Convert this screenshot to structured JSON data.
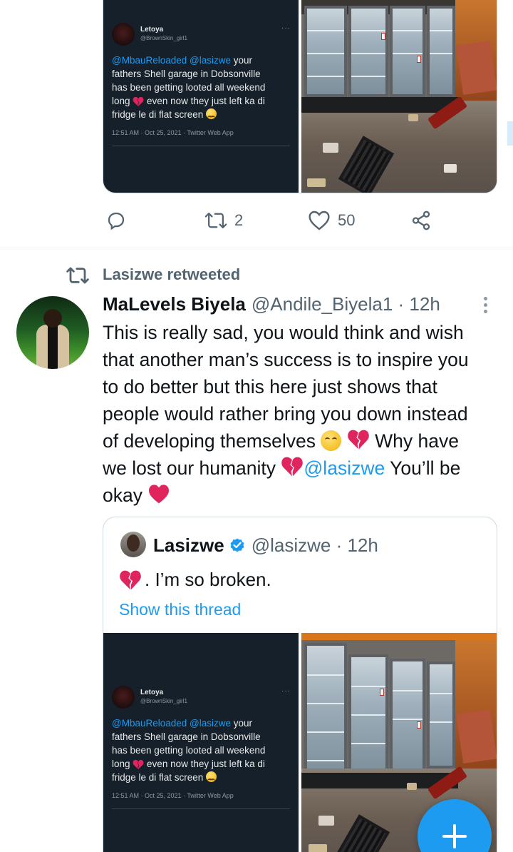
{
  "top_media": {
    "screenshot": {
      "name": "Letoya",
      "handle": "@BrownSkin_girl1",
      "more": "···",
      "text_mention_1": "@MbauReloaded",
      "text_mention_2": "@lasizwe",
      "text_line_1_tail": " your",
      "text_line_2": "fathers Shell garage in Dobsonville",
      "text_line_3": "has been getting looted all weekend",
      "text_line_4_a": "long",
      "text_line_4_b": " even now they just left ka di",
      "text_line_5": "fridge le di flat screen",
      "meta": "12:51 AM · Oct 25, 2021 · Twitter Web App"
    }
  },
  "top_actions": {
    "reply_count": "",
    "retweet_count": "2",
    "like_count": "50"
  },
  "retweet_header": {
    "label": "Lasizwe retweeted"
  },
  "tweet": {
    "author_name": "MaLevels Biyela",
    "author_handle": "@Andile_Biyela1 · 12h",
    "lines": [
      "This is really sad, you would think and wish",
      "that another man’s success is to inspire you",
      "to do better but this here just shows that",
      "people would rather bring you down instead"
    ],
    "line5_text": "of developing themselves ",
    "line5_tail": " Why have",
    "line6_text": "we lost our humanity ",
    "line6_mention": "@lasizwe",
    "line6_tail": " You’ll be",
    "line7_text": "okay "
  },
  "quoted_tweet": {
    "author_name": "Lasizwe",
    "author_handle": "@lasizwe · 12h",
    "text": ". I’m so broken.",
    "show_thread": "Show this thread"
  },
  "colors": {
    "accent": "#1d9bf0",
    "text_primary": "#0f1419",
    "text_secondary": "#536471",
    "heart_red": "#e0245e",
    "screenshot_bg": "#15202b"
  }
}
